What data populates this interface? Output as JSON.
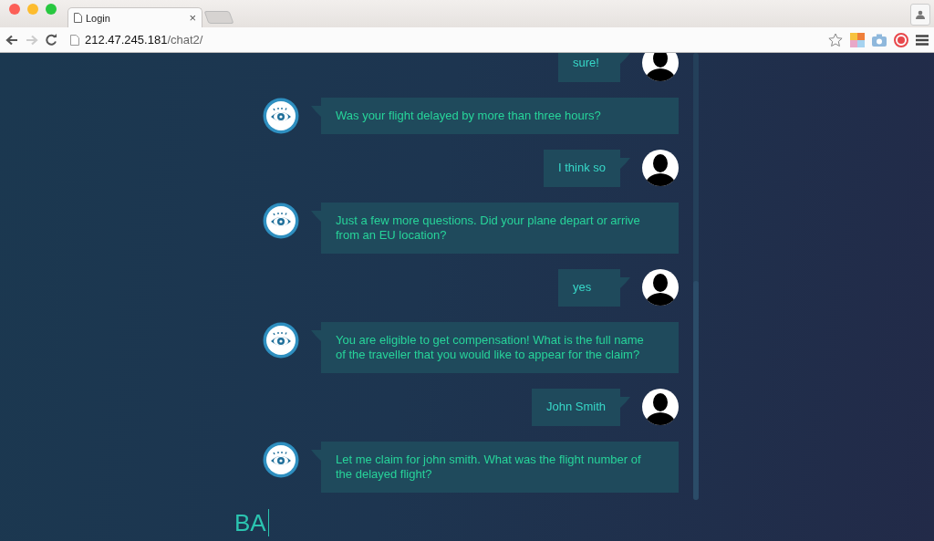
{
  "browser": {
    "tab": {
      "title": "Login",
      "close": "×",
      "selected": true
    },
    "url_host": "212.47.245.181",
    "url_path": "/chat2/"
  },
  "messages": [
    {
      "kind": "user",
      "text": "sure!"
    },
    {
      "kind": "bot",
      "text": "Was your flight delayed by more than three hours?"
    },
    {
      "kind": "user",
      "text": "I think so"
    },
    {
      "kind": "bot",
      "text": "Just a few more questions. Did your plane depart or arrive from an EU location?"
    },
    {
      "kind": "user",
      "text": "yes"
    },
    {
      "kind": "bot",
      "text": "You are eligible to get compensation! What is the full name of the traveller that you would like to appear for the claim?"
    },
    {
      "kind": "user",
      "text": "John Smith"
    },
    {
      "kind": "bot",
      "text": "Let me claim for john smith. What was the flight number of the delayed flight?"
    }
  ],
  "input": {
    "value": "BA"
  }
}
